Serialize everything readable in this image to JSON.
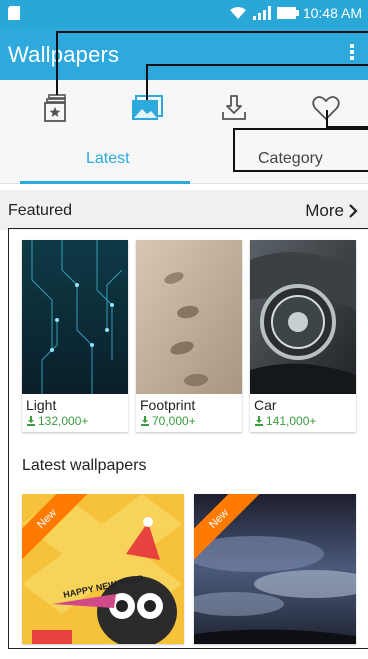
{
  "status_bar": {
    "time": "10:48 AM",
    "icons": [
      "sim-card-icon",
      "wifi-icon",
      "signal-icon",
      "battery-icon"
    ]
  },
  "app_bar": {
    "title": "Wallpapers",
    "menu_icon": "more-vertical-icon"
  },
  "icon_row": {
    "items": [
      {
        "name": "starred-collection-icon"
      },
      {
        "name": "image-gallery-icon"
      },
      {
        "name": "download-icon"
      },
      {
        "name": "favorites-heart-icon"
      }
    ]
  },
  "tabs": [
    {
      "label": "Latest",
      "active": true
    },
    {
      "label": "Category",
      "active": false
    }
  ],
  "featured": {
    "title": "Featured",
    "more_label": "More",
    "items": [
      {
        "name": "Light",
        "downloads": "132,000+"
      },
      {
        "name": "Footprint",
        "downloads": "70,000+"
      },
      {
        "name": "Car",
        "downloads": "141,000+"
      }
    ]
  },
  "latest": {
    "title": "Latest wallpapers",
    "items": [
      {
        "badge": "New",
        "art_text": "HAPPY NEW YEAR"
      },
      {
        "badge": "New"
      }
    ]
  },
  "colors": {
    "accent": "#2ea9dd",
    "download_green": "#3a9b3f",
    "ribbon_orange": "#ff7a00"
  }
}
